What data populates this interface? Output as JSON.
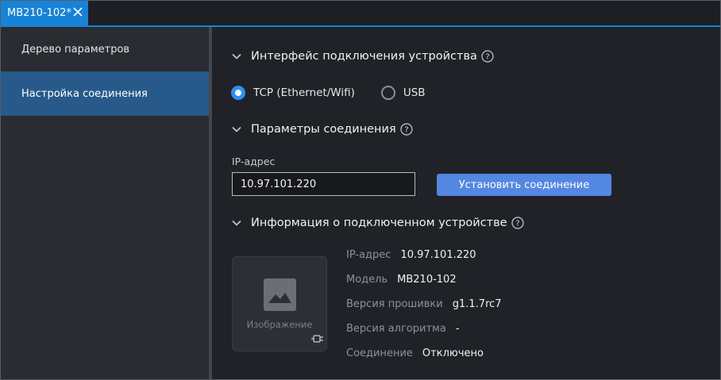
{
  "tab": {
    "title": "MB210-102*"
  },
  "sidebar": {
    "items": [
      {
        "label": "Дерево параметров"
      },
      {
        "label": "Настройка соединения"
      }
    ]
  },
  "sections": {
    "interface": {
      "title": "Интерфейс подключения устройства"
    },
    "params": {
      "title": "Параметры соединения"
    },
    "info": {
      "title": "Информация о подключенном устройстве"
    }
  },
  "radios": {
    "tcp": {
      "label": "TCP (Ethernet/Wifi)",
      "checked": true
    },
    "usb": {
      "label": "USB",
      "checked": false
    }
  },
  "connection": {
    "ip_label": "IP-адрес",
    "ip_value": "10.97.101.220",
    "connect_label": "Установить соединение"
  },
  "device": {
    "image_caption": "Изображение",
    "rows": [
      {
        "key": "IP-адрес",
        "value": "10.97.101.220"
      },
      {
        "key": "Модель",
        "value": "MB210-102"
      },
      {
        "key": "Версия прошивки",
        "value": "g1.1.7rc7"
      },
      {
        "key": "Версия алгоритма",
        "value": "-"
      },
      {
        "key": "Соединение",
        "value": "Отключено"
      }
    ]
  },
  "colors": {
    "accent": "#1683d6",
    "button": "#5487e2",
    "sidebar_active": "#275a8a",
    "radio_checked": "#2f8ff0"
  },
  "icons": {
    "tab_close": "close-icon",
    "section_toggle": "chevron-down-icon",
    "help": "help-circle-icon",
    "device_image": "image-placeholder-icon",
    "plug": "plug-icon"
  }
}
